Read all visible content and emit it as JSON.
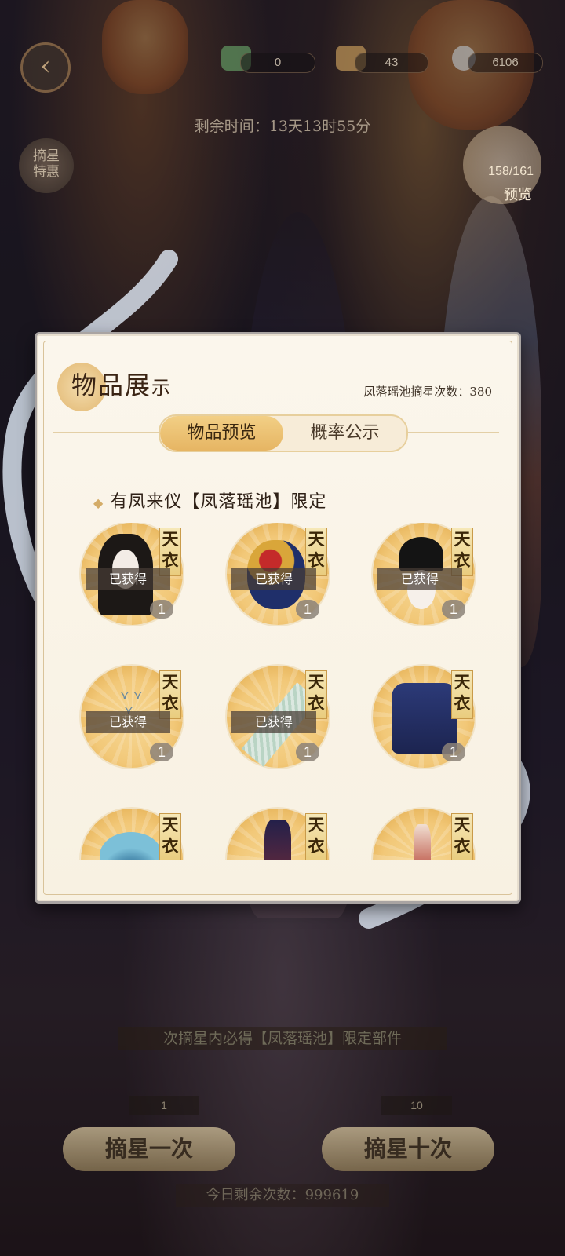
{
  "currencies": [
    {
      "icon": "book-icon",
      "value": "0"
    },
    {
      "icon": "gold-ingot-icon",
      "value": "43"
    },
    {
      "icon": "pearl-icon",
      "value": "6106"
    }
  ],
  "timer": "剩余时间：13天13时55分",
  "promo_label": "摘星\n特惠",
  "preview": {
    "count": "158/161",
    "label": "预览"
  },
  "modal": {
    "title_main": "物品展",
    "title_small": "示",
    "draw_count": "凤落瑶池摘星次数：380",
    "tabs": [
      {
        "label": "物品预览",
        "active": true
      },
      {
        "label": "概率公示",
        "active": false
      }
    ],
    "section_title": "有凤来仪【凤落瑶池】限定",
    "tag_text": "天\n衣",
    "owned_label": "已获得",
    "items": [
      {
        "kind": "hair",
        "owned": true,
        "qty": "1"
      },
      {
        "kind": "jewel",
        "owned": true,
        "qty": "1"
      },
      {
        "kind": "headpiece",
        "owned": true,
        "qty": "1"
      },
      {
        "kind": "birds",
        "owned": true,
        "qty": "1"
      },
      {
        "kind": "scarf",
        "owned": true,
        "qty": "1"
      },
      {
        "kind": "top",
        "owned": false,
        "qty": "1"
      },
      {
        "kind": "fan",
        "owned": false,
        "qty": ""
      },
      {
        "kind": "robe",
        "owned": false,
        "qty": ""
      },
      {
        "kind": "shoes",
        "owned": false,
        "qty": ""
      }
    ]
  },
  "bottom": {
    "guarantee": "次摘星内必得【凤落瑶池】限定部件",
    "draw_once": "摘星一次",
    "draw_ten": "摘星十次",
    "cost_once": "1",
    "cost_ten": "10",
    "remaining": "今日剩余次数：999619"
  }
}
